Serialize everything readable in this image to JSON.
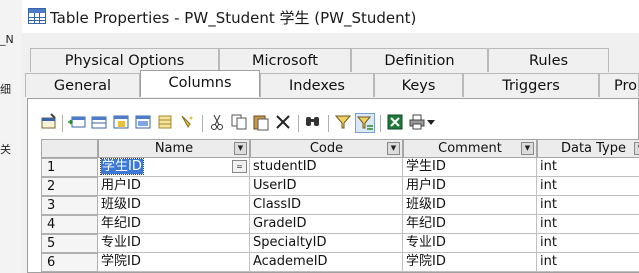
{
  "window": {
    "title": "Table Properties - PW_Student 学生 (PW_Student)",
    "icon": "table-icon"
  },
  "background_fragments": [
    "_N",
    "细",
    "关"
  ],
  "tabs_row1": [
    {
      "label": "Physical Options"
    },
    {
      "label": "Microsoft"
    },
    {
      "label": "Definition"
    },
    {
      "label": "Rules"
    }
  ],
  "tabs_row2": [
    {
      "label": "General"
    },
    {
      "label": "Columns"
    },
    {
      "label": "Indexes"
    },
    {
      "label": "Keys"
    },
    {
      "label": "Triggers"
    },
    {
      "label": "Pro"
    }
  ],
  "active_tab": "Columns",
  "toolbar": {
    "buttons": [
      "properties-icon",
      "insert-row-icon",
      "add-row-icon",
      "add-rows-icon",
      "reuse-columns-icon",
      "new-column-icon",
      "cut-icon",
      "copy-icon",
      "paste-icon",
      "delete-icon",
      "find-icon",
      "filter-icon",
      "column-filter-icon",
      "excel-export-icon",
      "print-icon",
      "dropdown-arrow-icon"
    ]
  },
  "columns": {
    "headers": [
      "Name",
      "Code",
      "Comment",
      "Data Type"
    ],
    "rows": [
      {
        "num": "1",
        "name": "学生ID",
        "code": "studentID",
        "comment": "学生ID",
        "type": "int"
      },
      {
        "num": "2",
        "name": "用户ID",
        "code": "UserID",
        "comment": "用户ID",
        "type": "int"
      },
      {
        "num": "3",
        "name": "班级ID",
        "code": "ClassID",
        "comment": "班级ID",
        "type": "int"
      },
      {
        "num": "4",
        "name": "年纪ID",
        "code": "GradeID",
        "comment": "年纪ID",
        "type": "int"
      },
      {
        "num": "5",
        "name": "专业ID",
        "code": "SpecialtyID",
        "comment": "专业ID",
        "type": "int"
      },
      {
        "num": "6",
        "name": "学院ID",
        "code": "AcademeID",
        "comment": "学院ID",
        "type": "int"
      }
    ],
    "selected_row": 1
  },
  "colors": {
    "selection": "#3b78d8",
    "excel_green": "#1f7a3a",
    "title_icon_blue": "#3a64a8"
  }
}
